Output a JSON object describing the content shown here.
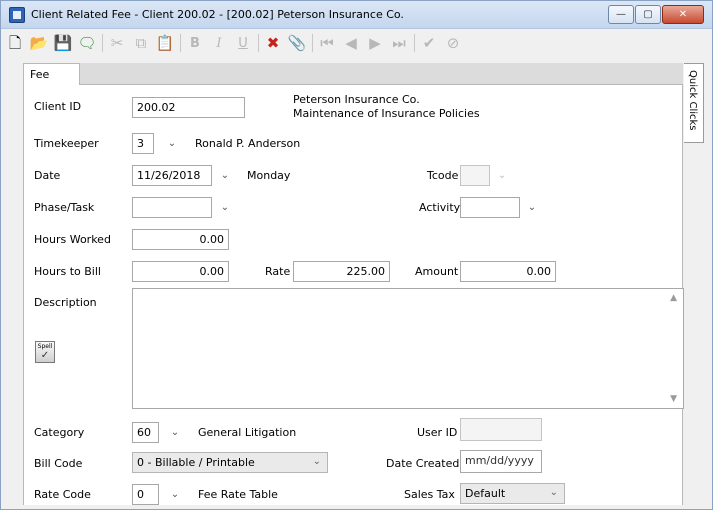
{
  "window": {
    "title": "Client Related Fee - Client 200.02 - [200.02] Peterson Insurance Co.",
    "buttons": {
      "minimize": "—",
      "maximize": "▢",
      "close": "✕"
    }
  },
  "toolbar": {
    "icons": [
      "new-icon",
      "open-icon",
      "save-icon",
      "notes-icon",
      "cut-icon",
      "copy-icon",
      "paste-icon",
      "bold-icon",
      "italic-icon",
      "underline-icon",
      "delete-icon",
      "attach-icon",
      "first-icon",
      "previous-icon",
      "next-icon",
      "last-icon",
      "accept-icon",
      "cancel-icon"
    ],
    "bold_glyph": "B",
    "italic_glyph": "I",
    "underline_glyph": "U"
  },
  "tabs": {
    "fee": "Fee"
  },
  "side_tab": {
    "quick_clicks": "Quick Clicks"
  },
  "form": {
    "client_id": {
      "label": "Client ID",
      "value": "200.02",
      "name": "Peterson Insurance Co.",
      "matter": "Maintenance of Insurance Policies"
    },
    "timekeeper": {
      "label": "Timekeeper",
      "value": "3",
      "name": "Ronald P. Anderson"
    },
    "date": {
      "label": "Date",
      "value": "11/26/2018",
      "weekday": "Monday"
    },
    "tcode": {
      "label": "Tcode",
      "value": ""
    },
    "phase_task": {
      "label": "Phase/Task",
      "value": ""
    },
    "activity": {
      "label": "Activity",
      "value": ""
    },
    "hours_worked": {
      "label": "Hours Worked",
      "value": "0.00"
    },
    "hours_to_bill": {
      "label": "Hours to Bill",
      "value": "0.00"
    },
    "rate": {
      "label": "Rate",
      "value": "225.00"
    },
    "amount": {
      "label": "Amount",
      "value": "0.00"
    },
    "description": {
      "label": "Description",
      "value": ""
    },
    "spell": {
      "label": "Spell"
    },
    "category": {
      "label": "Category",
      "value": "60",
      "name": "General Litigation"
    },
    "user_id": {
      "label": "User ID",
      "value": ""
    },
    "bill_code": {
      "label": "Bill Code",
      "value": "0 - Billable / Printable"
    },
    "date_created": {
      "label": "Date Created",
      "placeholder": "mm/dd/yyyy"
    },
    "rate_code": {
      "label": "Rate Code",
      "value": "0",
      "name": "Fee Rate Table"
    },
    "sales_tax": {
      "label": "Sales Tax",
      "value": "Default"
    }
  }
}
